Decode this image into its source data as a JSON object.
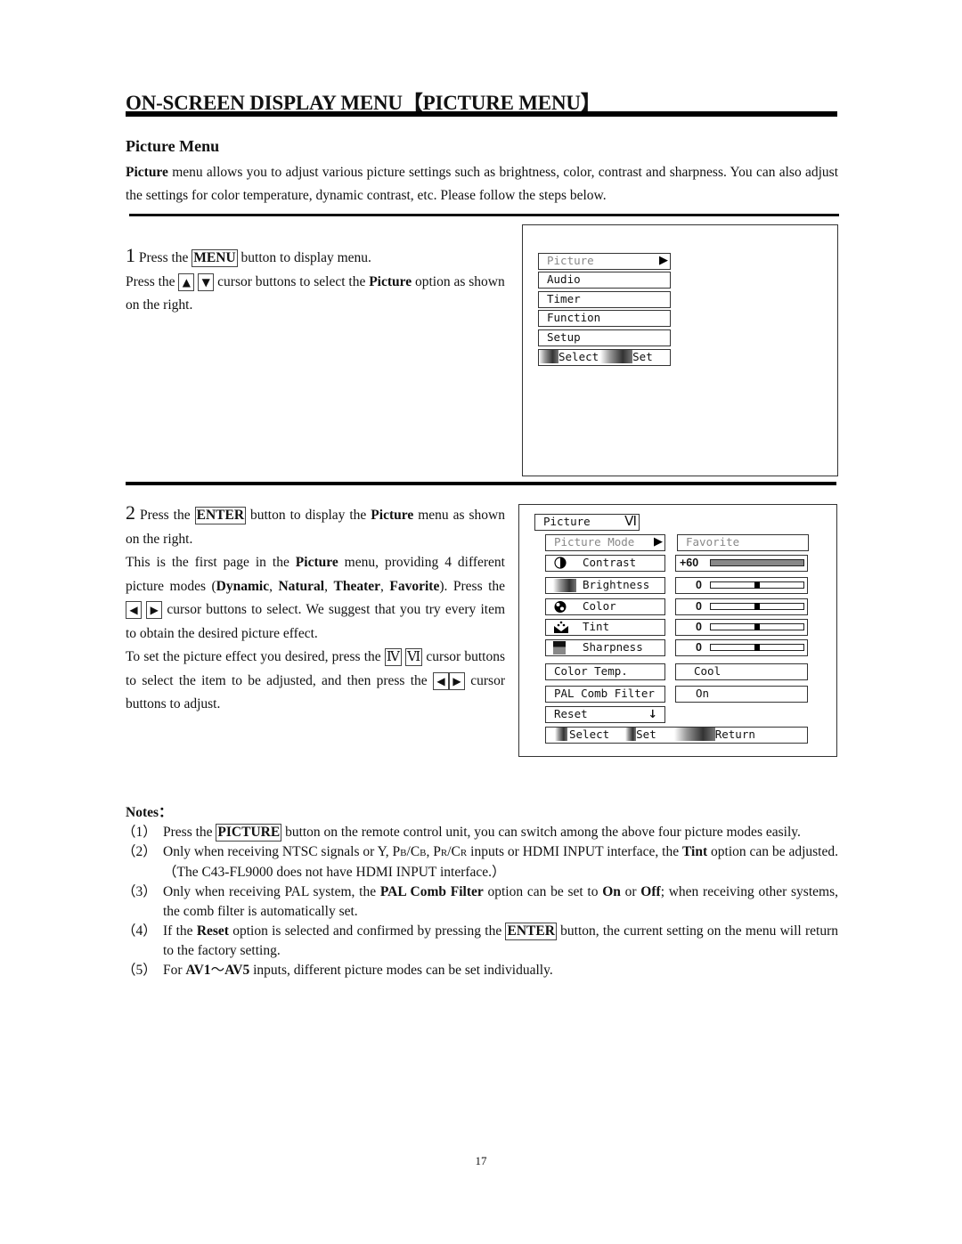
{
  "header": {
    "title": "ON-SCREEN DISPLAY MENU【PICTURE MENU】"
  },
  "section": {
    "title": "Picture Menu",
    "intro_bold": "Picture",
    "intro_text": " menu allows you to adjust various picture settings such as brightness, color, contrast and sharpness. You can also adjust the settings for color temperature, dynamic contrast, etc. Please follow the steps below."
  },
  "step1": {
    "number": "1",
    "t1": " Press the ",
    "key_menu": "MENU",
    "t2": " button to display menu.",
    "t3": "Press the ",
    "key_up": "▲",
    "key_down": "▼",
    "t4": " cursor buttons to select the ",
    "bold_picture": "Picture",
    "t5": " option as shown on the right."
  },
  "screen1": {
    "items": [
      {
        "label": "Picture",
        "selected": true
      },
      {
        "label": "Audio"
      },
      {
        "label": "Timer"
      },
      {
        "label": "Function"
      },
      {
        "label": "Setup"
      }
    ],
    "arrow": "▶",
    "footer": {
      "select": "Select",
      "set": "Set"
    }
  },
  "step2": {
    "number": "2",
    "t1": " Press the ",
    "key_enter": "ENTER",
    "t2": " button to display the ",
    "bold_picture": "Picture",
    "t3": " menu as shown on the right.",
    "t4": "This is the first page in the ",
    "bold_picture2": "Picture",
    "t5": " menu, providing 4 different picture modes (",
    "mode1": "Dynamic",
    "sep1": ", ",
    "mode2": "Natural",
    "sep2": ", ",
    "mode3": "Theater",
    "sep3": ", ",
    "mode4": "Favorite",
    "t6": "). Press the ",
    "key_left": "◀",
    "key_right": "▶",
    "t7": " cursor buttons to select. We suggest that you try every item to obtain the desired picture effect.",
    "t8": "To set the picture effect you desired, press the ",
    "key_iv": "Ⅳ",
    "key_vi": "Ⅵ",
    "t9": " cursor buttons to select the item to be adjusted, and then press the ",
    "t10": " cursor buttons to adjust."
  },
  "screen2": {
    "title": "Picture",
    "title_icon": "Ⅵ",
    "picture_mode": {
      "label": "Picture Mode",
      "value": "Favorite"
    },
    "arrow": "▶",
    "adjustments": [
      {
        "label": "Contrast",
        "value": "+60",
        "level": 1.0
      },
      {
        "label": "Brightness",
        "value": "0",
        "level": 0.5
      },
      {
        "label": "Color",
        "value": "0",
        "level": 0.5
      },
      {
        "label": "Tint",
        "value": "0",
        "level": 0.5
      },
      {
        "label": "Sharpness",
        "value": "0",
        "level": 0.5
      }
    ],
    "color_temp": {
      "label": "Color Temp.",
      "value": "Cool"
    },
    "pal_comb": {
      "label": "PAL Comb Filter",
      "value": "On"
    },
    "reset": {
      "label": "Reset",
      "icon": "↓"
    },
    "footer": {
      "select": "Select",
      "set": "Set",
      "return": "Return"
    }
  },
  "notes": {
    "title": "Notes：",
    "items": [
      {
        "num": "（1）",
        "a": "Press the ",
        "key": "PICTURE",
        "b": " button on the remote control unit, you can switch among the above four picture modes easily."
      },
      {
        "num": "（2）",
        "a": "Only when receiving NTSC signals or Y, P",
        "pb": "B",
        "slash1": "/C",
        "cb": "B",
        "comma": ", P",
        "pr": "R",
        "slash2": "/C",
        "cr": "R",
        "b": " inputs or HDMI INPUT interface, the ",
        "bold": "Tint",
        "c": " option can be adjusted.（The C43-FL9000 does not have HDMI INPUT interface.）"
      },
      {
        "num": "（3）",
        "a": "Only when receiving PAL system, the ",
        "bold1": "PAL Comb Filter",
        "b": " option can be set to ",
        "bold2": "On",
        "c": " or ",
        "bold3": "Off",
        "d": "; when receiving other systems, the comb filter is automatically set."
      },
      {
        "num": "（4）",
        "a": "If the ",
        "bold": "Reset",
        "b": " option is selected and confirmed by pressing the ",
        "key": "ENTER",
        "c": " button, the current setting on the menu will return to the factory setting."
      },
      {
        "num": "（5）",
        "a": "For ",
        "bold1": "AV1",
        "tilde": "～",
        "bold2": "AV5",
        "b": " inputs, different picture modes can be set individually."
      }
    ]
  },
  "page_number": "17"
}
